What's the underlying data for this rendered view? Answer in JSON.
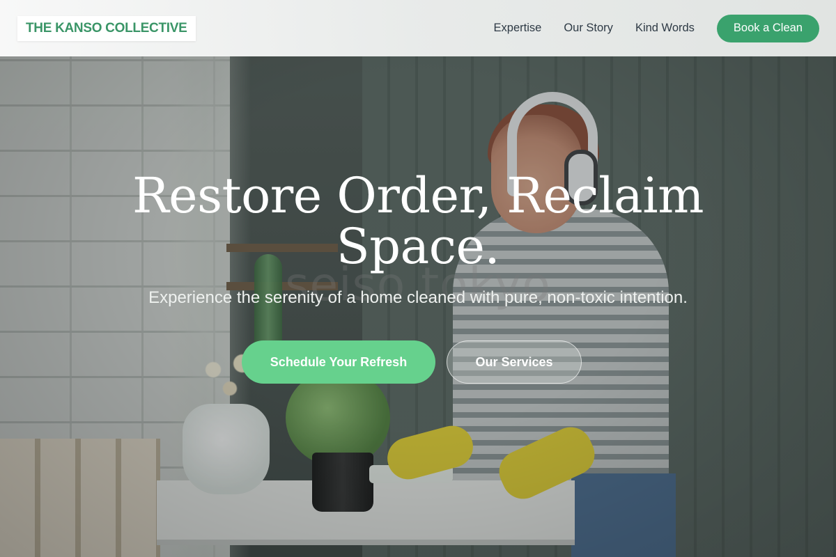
{
  "brand": {
    "name": "THE KANSO COLLECTIVE",
    "color": "#3a9567"
  },
  "nav": {
    "links": [
      "Expertise",
      "Our Story",
      "Kind Words"
    ],
    "cta_label": "Book a Clean",
    "cta_color": "#3aa26d"
  },
  "hero": {
    "headline_line1": "Restore Order, Reclaim",
    "headline_line2": "Space.",
    "subheadline": "Experience the serenity of a home cleaned with pure, non-toxic intention.",
    "watermark": "seiso tokyo",
    "primary_cta": "Schedule Your Refresh",
    "primary_cta_color": "#66d18d",
    "secondary_cta": "Our Services"
  }
}
